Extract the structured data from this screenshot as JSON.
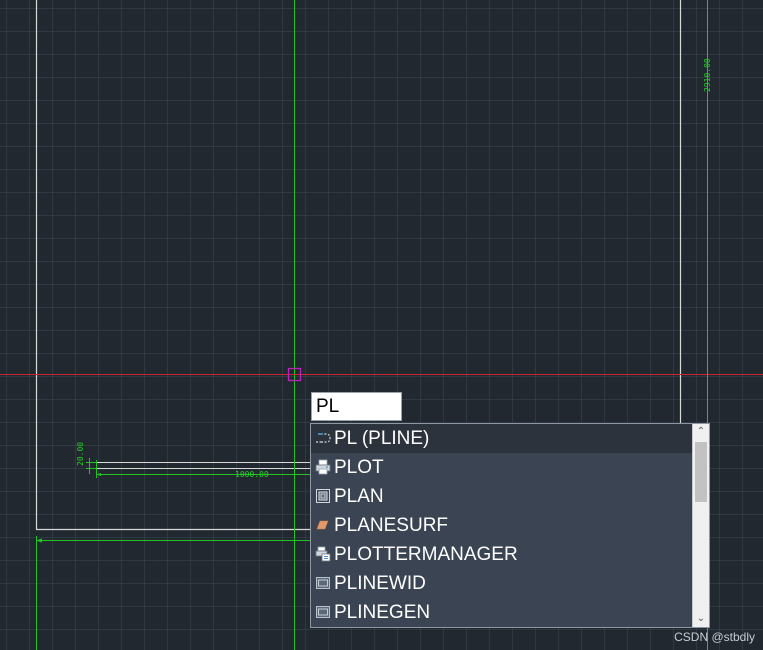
{
  "colors": {
    "background": "#212830",
    "grid": "#3c4652",
    "axis_x": "#c8282d",
    "axis_y": "#22c322",
    "geometry": "#d9d9d9",
    "dimension": "#22d322",
    "cursor": "#c020c0"
  },
  "dimensions": {
    "height_top_right": "2910.00",
    "small_left": "20.00",
    "width_bottom": "1000.00"
  },
  "command_input": {
    "value": "PL"
  },
  "autocomplete": {
    "items": [
      {
        "label": "PL (PLINE)",
        "icon": "polyline-icon",
        "selected": true
      },
      {
        "label": "PLOT",
        "icon": "printer-icon",
        "selected": false
      },
      {
        "label": "PLAN",
        "icon": "plan-view-icon",
        "selected": false
      },
      {
        "label": "PLANESURF",
        "icon": "planar-surface-icon",
        "selected": false
      },
      {
        "label": "PLOTTERMANAGER",
        "icon": "plotter-manager-icon",
        "selected": false
      },
      {
        "label": "PLINEWID",
        "icon": "system-variable-icon",
        "selected": false
      },
      {
        "label": "PLINEGEN",
        "icon": "system-variable-icon",
        "selected": false
      }
    ],
    "scroll_up_glyph": "⌃",
    "scroll_down_glyph": "⌄"
  },
  "watermark": "CSDN @stbdly"
}
